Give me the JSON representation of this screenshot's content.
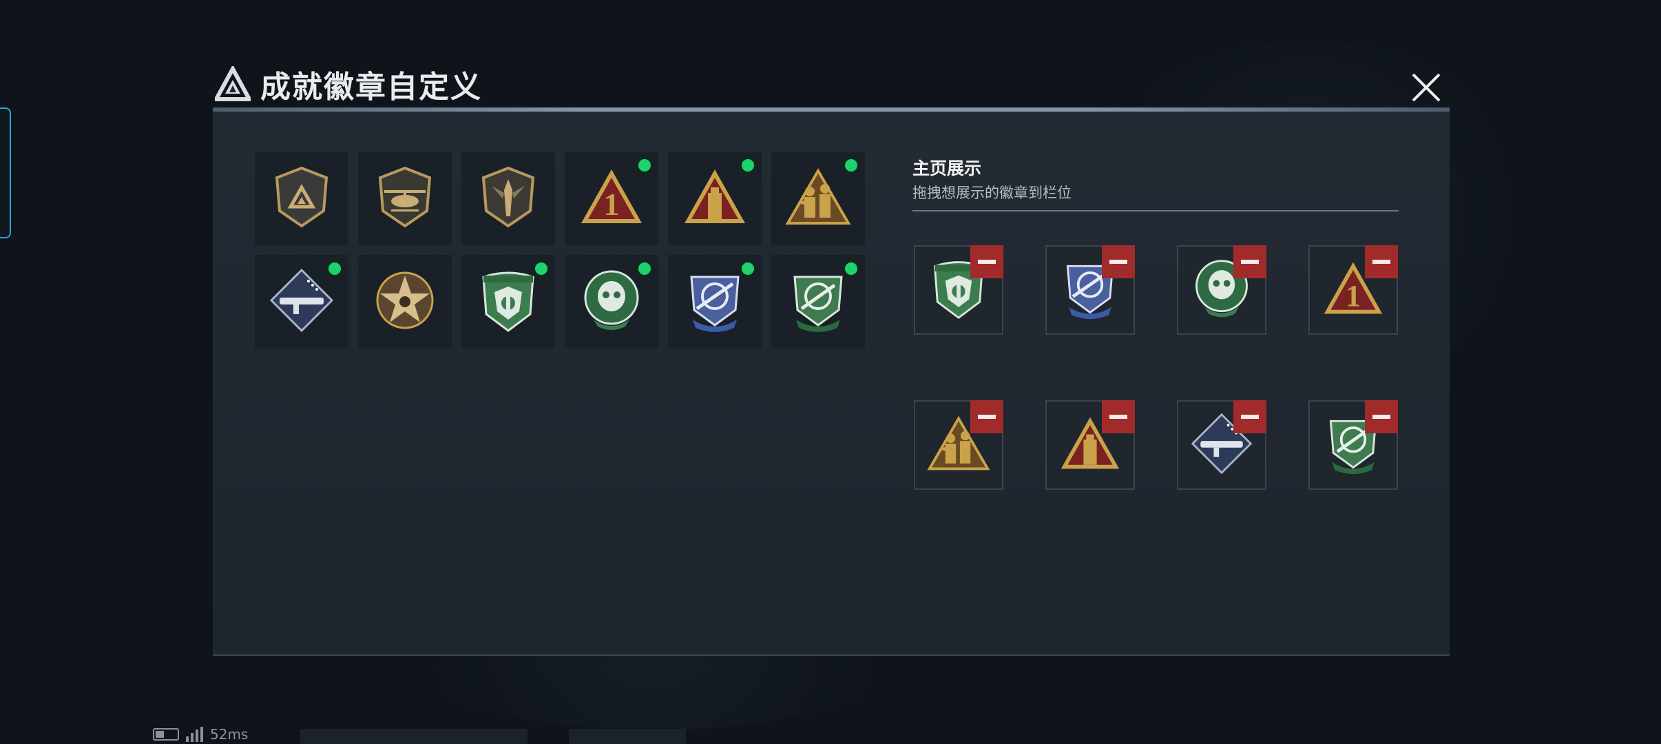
{
  "title": "成就徽章自定义",
  "showcase": {
    "heading": "主页展示",
    "subtitle": "拖拽想展示的徽章到栏位"
  },
  "status": {
    "ping": "52ms"
  },
  "colors": {
    "accent_green": "#1fd16f",
    "remove_red": "#a12b2b",
    "gold": "#c9a24a",
    "badge_green": "#3b7d4f",
    "badge_blue": "#3b5aa8"
  },
  "inventory": [
    {
      "icon": "shield-logo-badge-icon",
      "unlocked": false
    },
    {
      "icon": "helicopter-badge-icon",
      "unlocked": false
    },
    {
      "icon": "dagger-shield-badge-icon",
      "unlocked": false
    },
    {
      "icon": "triangle-number-one-badge-icon",
      "unlocked": true
    },
    {
      "icon": "triangle-tower-badge-icon",
      "unlocked": true
    },
    {
      "icon": "triangle-soldiers-badge-icon",
      "unlocked": true
    },
    {
      "icon": "diamond-rocket-launcher-badge-icon",
      "unlocked": true
    },
    {
      "icon": "star-skull-badge-icon",
      "unlocked": false
    },
    {
      "icon": "green-shield-crest-badge-icon",
      "unlocked": true
    },
    {
      "icon": "green-skull-wreath-badge-icon",
      "unlocked": true
    },
    {
      "icon": "blue-crosshair-rifle-badge-icon",
      "unlocked": true
    },
    {
      "icon": "green-crosshair-knife-badge-icon",
      "unlocked": true
    }
  ],
  "slots": [
    {
      "icon": "green-shield-crest-badge-icon"
    },
    {
      "icon": "blue-crosshair-rifle-badge-icon"
    },
    {
      "icon": "green-skull-wreath-badge-icon"
    },
    {
      "icon": "triangle-number-one-badge-icon"
    },
    {
      "icon": "triangle-soldiers-badge-icon"
    },
    {
      "icon": "triangle-tower-badge-icon"
    },
    {
      "icon": "diamond-rocket-launcher-badge-icon"
    },
    {
      "icon": "green-crosshair-knife-badge-icon"
    }
  ]
}
